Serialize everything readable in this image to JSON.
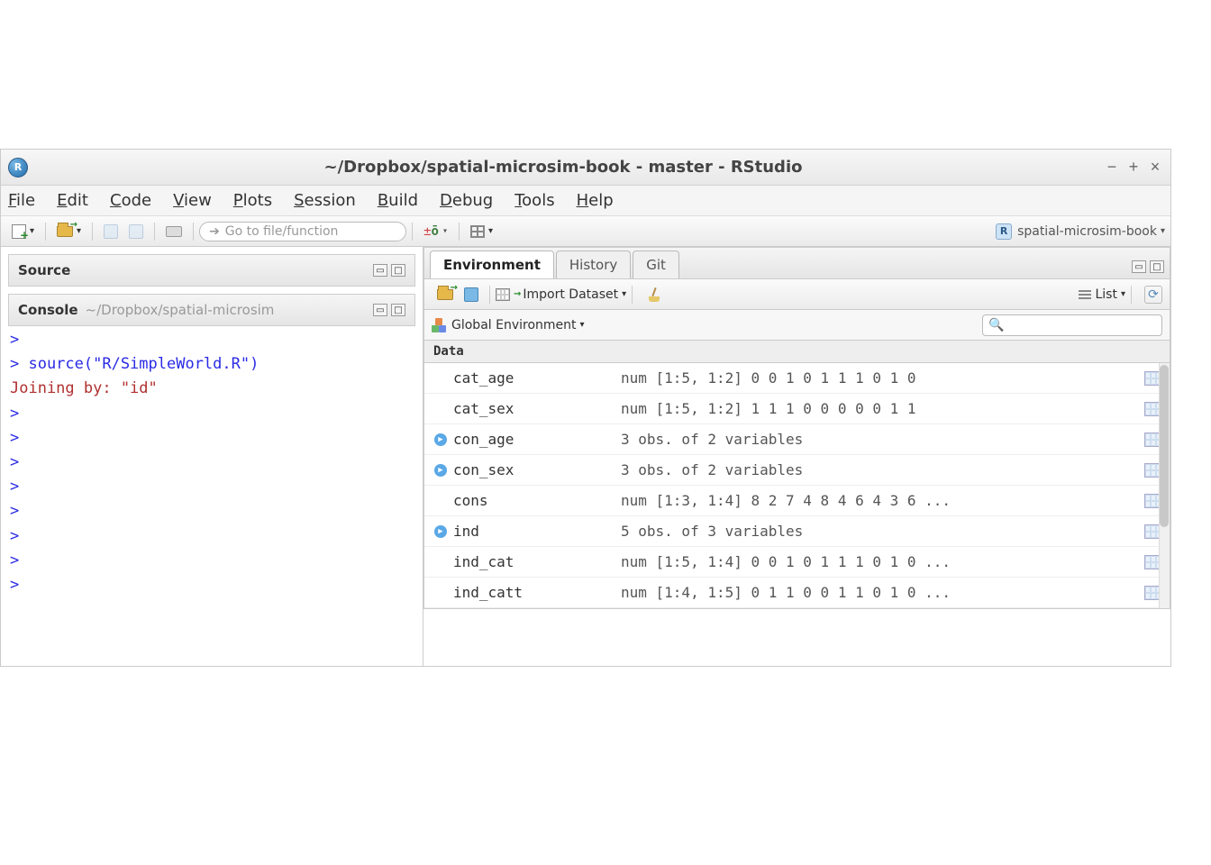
{
  "window": {
    "title": "~/Dropbox/spatial-microsim-book - master - RStudio",
    "project_name": "spatial-microsim-book"
  },
  "menus": {
    "file": "File",
    "edit": "Edit",
    "code": "Code",
    "view": "View",
    "plots": "Plots",
    "session": "Session",
    "build": "Build",
    "debug": "Debug",
    "tools": "Tools",
    "help": "Help"
  },
  "toolbar": {
    "goto_placeholder": "Go to file/function"
  },
  "panes": {
    "source_label": "Source",
    "console_label": "Console",
    "console_path": "~/Dropbox/spatial-microsim"
  },
  "console_lines": [
    {
      "type": "prompt",
      "text": ">"
    },
    {
      "type": "cmd",
      "text": "> source(\"R/SimpleWorld.R\")"
    },
    {
      "type": "msg",
      "text": "Joining by: \"id\""
    },
    {
      "type": "prompt",
      "text": ">"
    },
    {
      "type": "prompt",
      "text": ">"
    },
    {
      "type": "prompt",
      "text": ">"
    },
    {
      "type": "prompt",
      "text": ">"
    },
    {
      "type": "prompt",
      "text": ">"
    },
    {
      "type": "prompt",
      "text": ">"
    },
    {
      "type": "prompt",
      "text": ">"
    },
    {
      "type": "prompt",
      "text": ">"
    }
  ],
  "env": {
    "tabs": {
      "environment": "Environment",
      "history": "History",
      "git": "Git"
    },
    "import_label": "Import Dataset",
    "list_label": "List",
    "scope_label": "Global Environment",
    "section_data": "Data",
    "rows": [
      {
        "expand": false,
        "name": "cat_age",
        "value": "num [1:5, 1:2] 0 0 1 0 1 1 1 0 1 0"
      },
      {
        "expand": false,
        "name": "cat_sex",
        "value": "num [1:5, 1:2] 1 1 1 0 0 0 0 0 1 1"
      },
      {
        "expand": true,
        "name": "con_age",
        "value": "3 obs. of 2 variables"
      },
      {
        "expand": true,
        "name": "con_sex",
        "value": "3 obs. of 2 variables"
      },
      {
        "expand": false,
        "name": "cons",
        "value": "num [1:3, 1:4] 8 2 7 4 8 4 6 4 3 6 ..."
      },
      {
        "expand": true,
        "name": "ind",
        "value": "5 obs. of 3 variables"
      },
      {
        "expand": false,
        "name": "ind_cat",
        "value": "num [1:5, 1:4] 0 0 1 0 1 1 1 0 1 0 ..."
      },
      {
        "expand": false,
        "name": "ind_catt",
        "value": "num [1:4, 1:5] 0 1 1 0 0 1 1 0 1 0 ..."
      }
    ]
  }
}
